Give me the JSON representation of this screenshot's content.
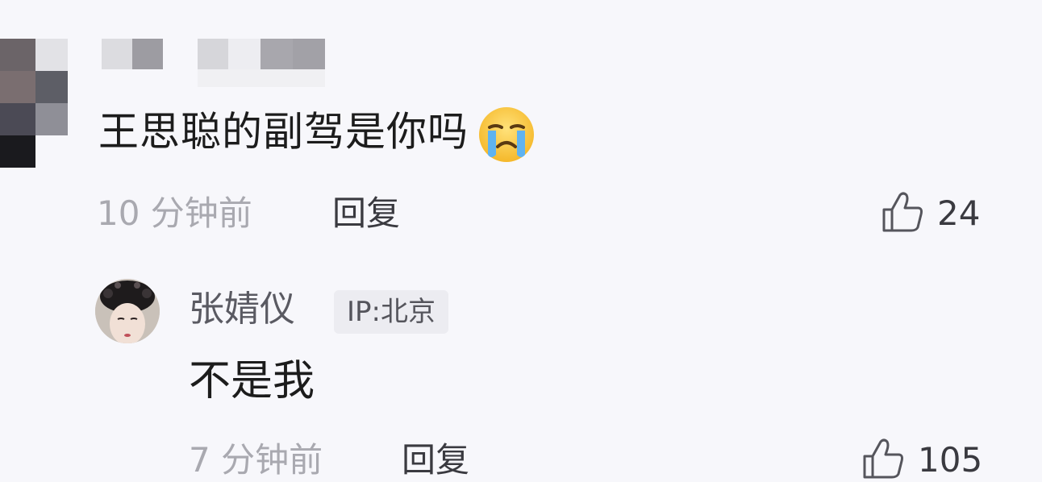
{
  "comment": {
    "text": "王思聪的副驾是你吗",
    "emoji": "crying-face",
    "time": "10 分钟前",
    "reply_label": "回复",
    "likes": "24"
  },
  "reply": {
    "username": "张婧仪",
    "ip_label": "IP:北京",
    "text": "不是我",
    "time": "7 分钟前",
    "reply_label": "回复",
    "likes": "105"
  },
  "colors": {
    "background": "#f7f7fb",
    "muted_text": "#a9a9b0",
    "primary_text": "#1c1c1c"
  }
}
